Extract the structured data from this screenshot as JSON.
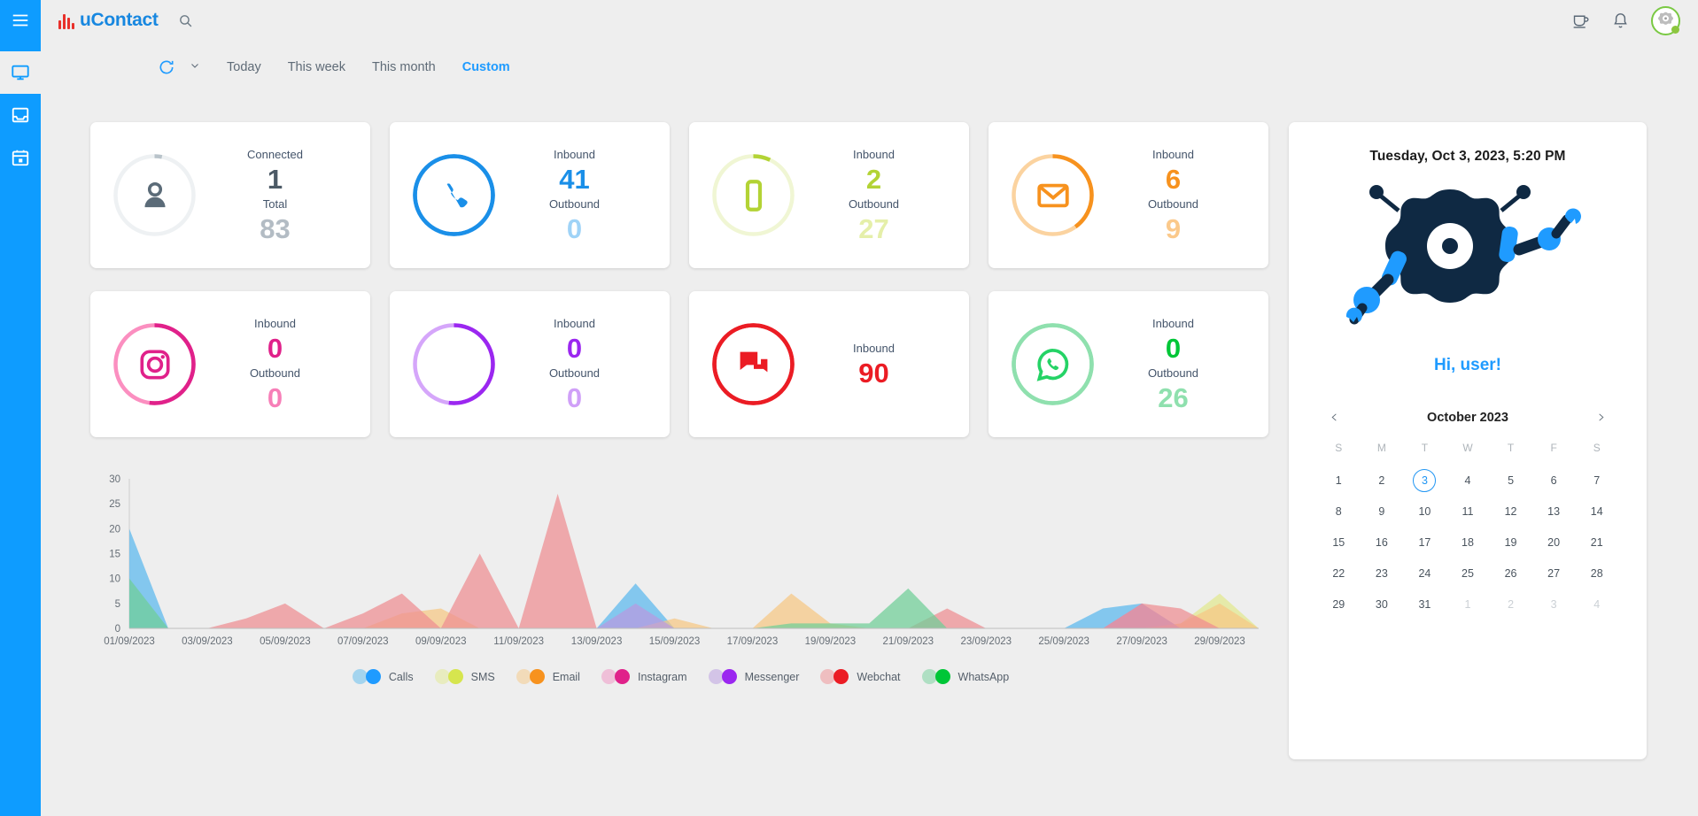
{
  "app": {
    "brand": "uContact",
    "brand_accent": "#1787e0",
    "brand_mark_color": "#e8302a"
  },
  "sidebar": {
    "items": [
      {
        "name": "menu-toggle",
        "icon": "hamburger-icon",
        "active": false
      },
      {
        "name": "dashboard",
        "icon": "monitor-icon",
        "active": true
      },
      {
        "name": "inbox",
        "icon": "inbox-icon",
        "active": false
      },
      {
        "name": "calendar",
        "icon": "calendar-icon",
        "active": false
      }
    ]
  },
  "topbar": {
    "search_icon": "search-icon",
    "coffee_icon": "coffee-cup-icon",
    "bell_icon": "notification-bell-icon",
    "avatar_status": "online",
    "avatar_status_color": "#8cc63f"
  },
  "filterbar": {
    "refresh_icon": "refresh-icon",
    "caret_icon": "chevron-down-icon",
    "ranges": [
      {
        "label": "Today",
        "active": false
      },
      {
        "label": "This week",
        "active": false
      },
      {
        "label": "This month",
        "active": false
      },
      {
        "label": "Custom",
        "active": true
      }
    ]
  },
  "cards": [
    {
      "id": "connected-agents",
      "icon": "person-icon",
      "color": "#5b6b78",
      "ring_color": "#b9c3ca",
      "ring_track": "#eef1f3",
      "ring_pct": 3,
      "label_top": "Connected",
      "value_top": "1",
      "label_bottom": "Total",
      "value_bottom": "83",
      "value_top_color": "#4c5a66",
      "value_bottom_color": "#b3bcc4"
    },
    {
      "id": "calls",
      "icon": "phone-icon",
      "color": "#1a8fe8",
      "ring_color": "#1a8fe8",
      "ring_track": "#1a8fe8",
      "ring_pct": 100,
      "label_top": "Inbound",
      "value_top": "41",
      "label_bottom": "Outbound",
      "value_bottom": "0",
      "value_top_color": "#1a8fe8",
      "value_bottom_color": "#9fd3f7"
    },
    {
      "id": "sms",
      "icon": "mobile-icon",
      "color": "#b3d335",
      "ring_color": "#b3d335",
      "ring_track": "#f0f6d4",
      "ring_pct": 7,
      "label_top": "Inbound",
      "value_top": "2",
      "label_bottom": "Outbound",
      "value_bottom": "27",
      "value_top_color": "#b3d335",
      "value_bottom_color": "#e5efa9"
    },
    {
      "id": "email",
      "icon": "envelope-icon",
      "color": "#f7921e",
      "ring_color": "#f7921e",
      "ring_track": "#fbd3a0",
      "ring_pct": 40,
      "label_top": "Inbound",
      "value_top": "6",
      "label_bottom": "Outbound",
      "value_bottom": "9",
      "value_top_color": "#f7921e",
      "value_bottom_color": "#fbc98b"
    },
    {
      "id": "instagram",
      "icon": "instagram-icon",
      "color": "#e0218a",
      "ring_color": "#e0218a",
      "ring_track": "#fb8fc0",
      "ring_pct": 52,
      "label_top": "Inbound",
      "value_top": "0",
      "label_bottom": "Outbound",
      "value_bottom": "0",
      "value_top_color": "#e0218a",
      "value_bottom_color": "#f77fb8"
    },
    {
      "id": "messenger",
      "icon": "messenger-icon",
      "color": "#9b27f0",
      "ring_color": "#9b27f0",
      "ring_track": "#d5a6fa",
      "ring_pct": 52,
      "label_top": "Inbound",
      "value_top": "0",
      "label_bottom": "Outbound",
      "value_bottom": "0",
      "value_top_color": "#9b27f0",
      "value_bottom_color": "#d0a0f8"
    },
    {
      "id": "webchat",
      "icon": "chat-bubbles-icon",
      "color": "#eb1c24",
      "ring_color": "#eb1c24",
      "ring_track": "#eb1c24",
      "ring_pct": 100,
      "label_top": "Inbound",
      "value_top": "90",
      "label_bottom": "",
      "value_bottom": "",
      "value_top_color": "#eb1c24",
      "value_bottom_color": "#eb1c24"
    },
    {
      "id": "whatsapp",
      "icon": "whatsapp-icon",
      "color": "#25d366",
      "ring_color": "#8fe0ae",
      "ring_track": "#8fe0ae",
      "ring_pct": 100,
      "label_top": "Inbound",
      "value_top": "0",
      "label_bottom": "Outbound",
      "value_bottom": "26",
      "value_top_color": "#00c637",
      "value_bottom_color": "#8fe0ae"
    }
  ],
  "right_panel": {
    "datetime": "Tuesday,  Oct 3, 2023, 5:20 PM",
    "greeting": "Hi, user!",
    "robot_body_color": "#0f2943",
    "robot_accent_color": "#1f9bff",
    "calendar": {
      "title": "October 2023",
      "prev_icon": "chevron-left-icon",
      "next_icon": "chevron-right-icon",
      "dow": [
        "S",
        "M",
        "T",
        "W",
        "T",
        "F",
        "S"
      ],
      "selected": 3,
      "weeks": [
        [
          {
            "d": "1"
          },
          {
            "d": "2"
          },
          {
            "d": "3",
            "sel": true
          },
          {
            "d": "4"
          },
          {
            "d": "5"
          },
          {
            "d": "6"
          },
          {
            "d": "7"
          }
        ],
        [
          {
            "d": "8"
          },
          {
            "d": "9"
          },
          {
            "d": "10"
          },
          {
            "d": "11"
          },
          {
            "d": "12"
          },
          {
            "d": "13"
          },
          {
            "d": "14"
          }
        ],
        [
          {
            "d": "15"
          },
          {
            "d": "16"
          },
          {
            "d": "17"
          },
          {
            "d": "18"
          },
          {
            "d": "19"
          },
          {
            "d": "20"
          },
          {
            "d": "21"
          }
        ],
        [
          {
            "d": "22"
          },
          {
            "d": "23"
          },
          {
            "d": "24"
          },
          {
            "d": "25"
          },
          {
            "d": "26"
          },
          {
            "d": "27"
          },
          {
            "d": "28"
          }
        ],
        [
          {
            "d": "29"
          },
          {
            "d": "30"
          },
          {
            "d": "31"
          },
          {
            "d": "1",
            "muted": true
          },
          {
            "d": "2",
            "muted": true
          },
          {
            "d": "3",
            "muted": true
          },
          {
            "d": "4",
            "muted": true
          }
        ]
      ]
    }
  },
  "chart_data": {
    "type": "area",
    "title": "",
    "xlabel": "",
    "ylabel": "",
    "ylim": [
      0,
      30
    ],
    "yticks": [
      0,
      5,
      10,
      15,
      20,
      25,
      30
    ],
    "grid": false,
    "legend_position": "bottom",
    "x": [
      "01/09/2023",
      "02/09/2023",
      "03/09/2023",
      "04/09/2023",
      "05/09/2023",
      "06/09/2023",
      "07/09/2023",
      "08/09/2023",
      "09/09/2023",
      "10/09/2023",
      "11/09/2023",
      "12/09/2023",
      "13/09/2023",
      "14/09/2023",
      "15/09/2023",
      "16/09/2023",
      "17/09/2023",
      "18/09/2023",
      "19/09/2023",
      "20/09/2023",
      "21/09/2023",
      "22/09/2023",
      "23/09/2023",
      "24/09/2023",
      "25/09/2023",
      "26/09/2023",
      "27/09/2023",
      "28/09/2023",
      "29/09/2023",
      "30/09/2023"
    ],
    "xticks": [
      "01/09/2023",
      "03/09/2023",
      "05/09/2023",
      "07/09/2023",
      "09/09/2023",
      "11/09/2023",
      "13/09/2023",
      "15/09/2023",
      "17/09/2023",
      "19/09/2023",
      "21/09/2023",
      "23/09/2023",
      "25/09/2023",
      "27/09/2023",
      "29/09/2023"
    ],
    "series": [
      {
        "name": "Calls",
        "color": "#5ab9ee",
        "values": [
          20,
          0,
          0,
          0,
          0,
          0,
          0,
          0,
          0,
          0,
          0,
          0,
          0,
          9,
          0,
          0,
          0,
          0,
          0,
          0,
          0,
          0,
          0,
          0,
          0,
          4,
          5,
          0,
          0,
          0
        ]
      },
      {
        "name": "SMS",
        "color": "#e2e98f",
        "values": [
          0,
          0,
          0,
          0,
          0,
          0,
          0,
          0,
          0,
          0,
          0,
          0,
          0,
          0,
          0,
          0,
          0,
          0,
          0,
          0,
          0,
          0,
          0,
          0,
          0,
          0,
          0,
          1,
          7,
          0
        ]
      },
      {
        "name": "Email",
        "color": "#f6c884",
        "values": [
          0,
          0,
          0,
          0,
          0,
          0,
          0,
          3,
          4,
          0,
          0,
          0,
          0,
          0,
          2,
          0,
          0,
          7,
          1,
          0,
          0,
          0,
          0,
          0,
          0,
          0,
          0,
          1,
          5,
          0
        ]
      },
      {
        "name": "Instagram",
        "color": "#ef8fc2",
        "values": [
          0,
          0,
          0,
          0,
          0,
          0,
          0,
          0,
          0,
          0,
          0,
          0,
          0,
          0,
          0,
          0,
          0,
          0,
          0,
          0,
          0,
          0,
          0,
          0,
          0,
          0,
          0,
          0,
          0,
          0
        ]
      },
      {
        "name": "Messenger",
        "color": "#b89ae0",
        "values": [
          0,
          0,
          0,
          0,
          0,
          0,
          0,
          0,
          0,
          0,
          0,
          0,
          0,
          5,
          0,
          0,
          0,
          0,
          0,
          0,
          0,
          0,
          0,
          0,
          0,
          0,
          5,
          0,
          0,
          0
        ]
      },
      {
        "name": "Webchat",
        "color": "#ef8e92",
        "values": [
          0,
          0,
          0,
          2,
          5,
          0,
          3,
          7,
          0,
          15,
          0,
          27,
          0,
          0,
          0,
          0,
          0,
          0,
          0,
          0,
          0,
          4,
          0,
          0,
          0,
          0,
          5,
          4,
          0,
          0
        ]
      },
      {
        "name": "WhatsApp",
        "color": "#6fcf97",
        "values": [
          10,
          0,
          0,
          0,
          0,
          0,
          0,
          0,
          0,
          0,
          0,
          0,
          0,
          0,
          0,
          0,
          0,
          1,
          1,
          1,
          8,
          0,
          0,
          0,
          0,
          0,
          0,
          0,
          0,
          0
        ]
      }
    ]
  }
}
